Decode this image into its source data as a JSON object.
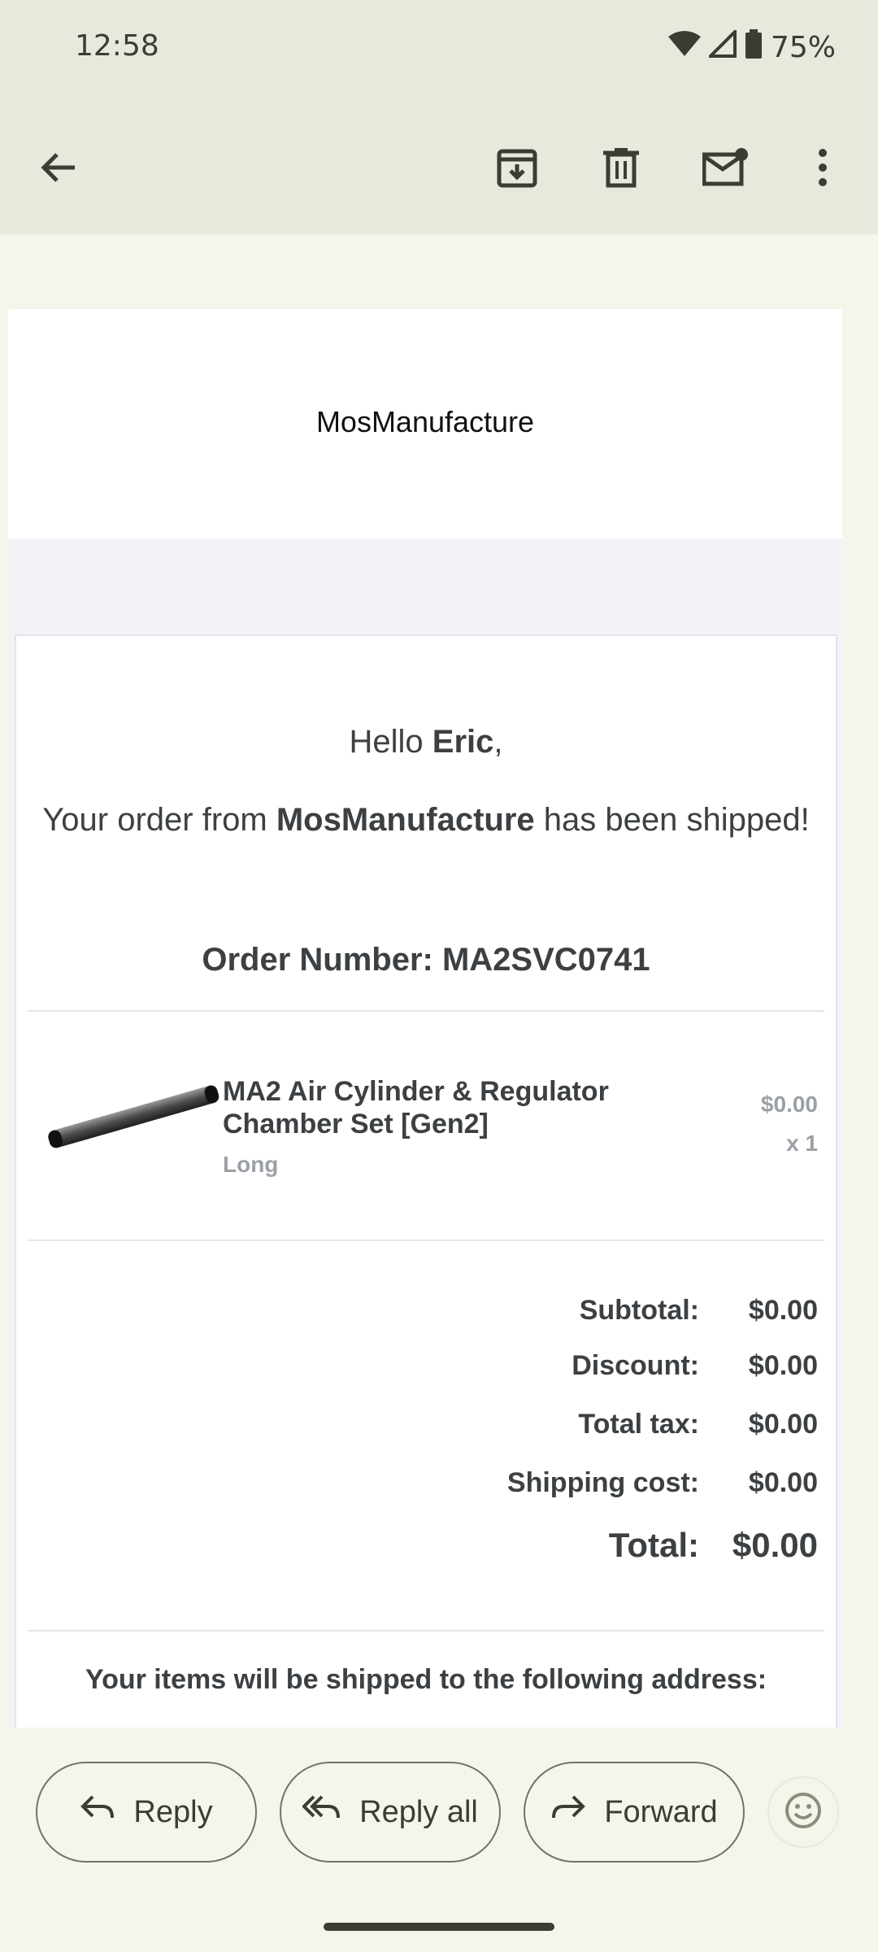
{
  "status_bar": {
    "time": "12:58",
    "battery": "75%"
  },
  "toolbar": {
    "icons": [
      "back-arrow-icon",
      "archive-icon",
      "delete-icon",
      "mark-unread-icon",
      "more-vert-icon"
    ]
  },
  "email": {
    "brand": "MosManufacture",
    "greeting_prefix": "Hello ",
    "customer_name": "Eric",
    "greeting_suffix": ",",
    "shipped_prefix": "Your order from ",
    "shop_name": "MosManufacture",
    "shipped_suffix": " has been shipped!",
    "order_number": "Order Number: MA2SVC0741",
    "product": {
      "name": "MA2 Air Cylinder & Regulator Chamber Set [Gen2]",
      "variant": "Long",
      "price": "$0.00",
      "qty": "x 1"
    },
    "totals": {
      "subtotal_label": "Subtotal:",
      "subtotal": "$0.00",
      "discount_label": "Discount:",
      "discount": "$0.00",
      "tax_label": "Total tax:",
      "tax": "$0.00",
      "shipping_label": "Shipping cost:",
      "shipping": "$0.00",
      "total_label": "Total:",
      "total": "$0.00"
    },
    "shipping_notice": "Your items will be shipped to the following address:"
  },
  "actions": {
    "reply": "Reply",
    "reply_all": "Reply all",
    "forward": "Forward"
  }
}
